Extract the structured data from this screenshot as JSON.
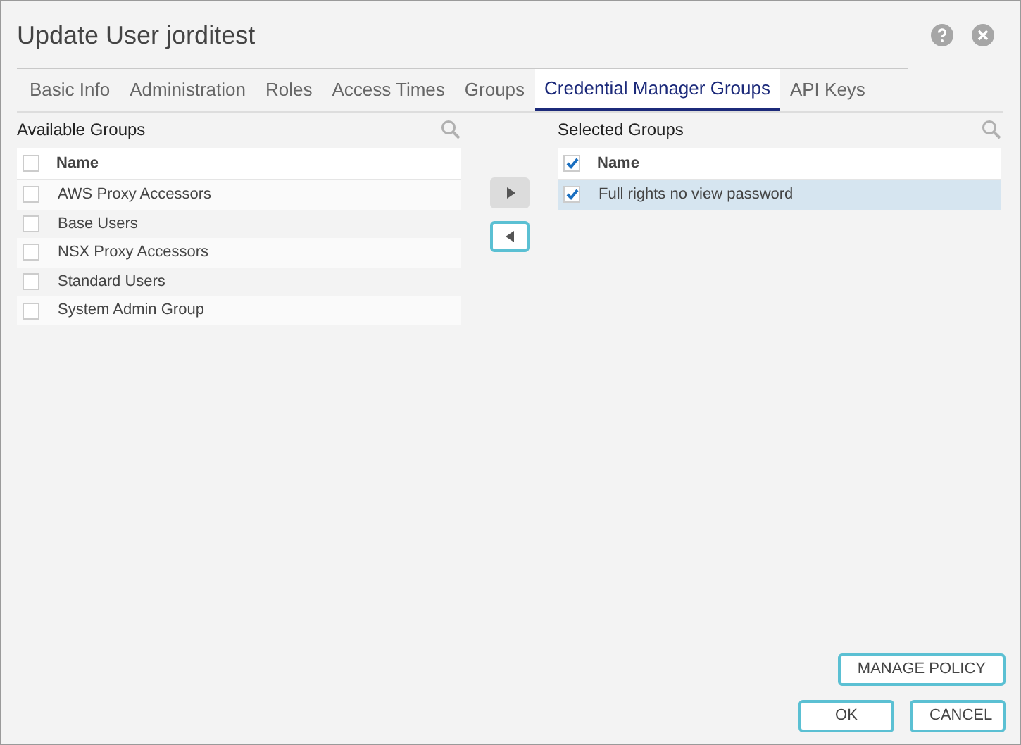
{
  "window": {
    "title": "Update User jorditest"
  },
  "tabs": [
    {
      "label": "Basic Info",
      "selected": false
    },
    {
      "label": "Administration",
      "selected": false
    },
    {
      "label": "Roles",
      "selected": false
    },
    {
      "label": "Access Times",
      "selected": false
    },
    {
      "label": "Groups",
      "selected": false
    },
    {
      "label": "Credential Manager Groups",
      "selected": true
    },
    {
      "label": "API Keys",
      "selected": false
    }
  ],
  "available": {
    "title": "Available Groups",
    "column": "Name",
    "all_checked": false,
    "rows": [
      {
        "name": "AWS Proxy Accessors",
        "checked": false
      },
      {
        "name": "Base Users",
        "checked": false
      },
      {
        "name": "NSX Proxy Accessors",
        "checked": false
      },
      {
        "name": "Standard Users",
        "checked": false
      },
      {
        "name": "System Admin Group",
        "checked": false
      }
    ]
  },
  "move_buttons": [
    {
      "kind": "right",
      "disabled": true
    },
    {
      "kind": "left",
      "disabled": false
    }
  ],
  "selected": {
    "title": "Selected Groups",
    "column": "Name",
    "all_checked": true,
    "rows": [
      {
        "name": "Full rights no view password",
        "checked": true
      }
    ]
  },
  "buttons": {
    "manage": "MANAGE POLICY",
    "ok": "OK",
    "cancel": "CANCEL"
  }
}
